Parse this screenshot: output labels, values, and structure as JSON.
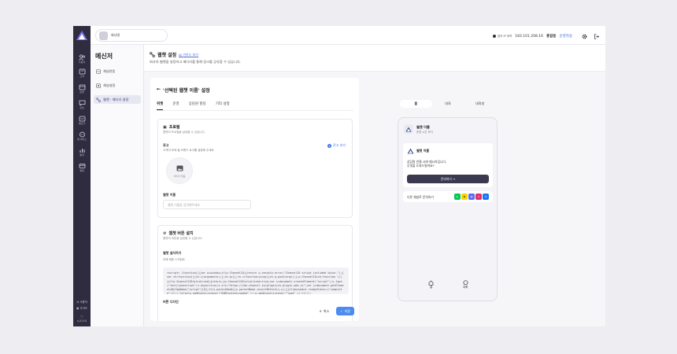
{
  "topbar": {
    "workspace_name": "회사명",
    "ip_label": "접속 IP 대역",
    "ip_address": "183.101.208.16",
    "user_name": "홍길동",
    "user_role": "운영자용"
  },
  "rail": {
    "items": [
      {
        "label": "사용자",
        "icon": "users-icon"
      },
      {
        "label": "고객",
        "icon": "customer-icon"
      },
      {
        "label": "운영",
        "icon": "operation-icon"
      },
      {
        "label": "상담",
        "icon": "chat-icon"
      },
      {
        "label": "메신저",
        "icon": "messenger-icon"
      },
      {
        "label": "봇/서비스",
        "icon": "bot-icon"
      },
      {
        "label": "통계",
        "icon": "stats-icon"
      },
      {
        "label": "결제",
        "icon": "billing-icon"
      }
    ],
    "bottom": {
      "user_label": "사용자",
      "help_label": "가이드",
      "version": "v.2.0.0"
    }
  },
  "sidebar": {
    "title": "메신저",
    "items": [
      {
        "label": "채널연동",
        "active": false
      },
      {
        "label": "채널설정",
        "active": false
      },
      {
        "label": "웹챗 · 메디리 설정",
        "active": true
      }
    ]
  },
  "page_header": {
    "title": "웹챗 설정",
    "guide_link": "가이드 보기",
    "description": "회사의 웹챗을 설정하고 메디리를 통해 링크를 공유할 수 있습니다."
  },
  "panel": {
    "back_title": "'선택된 웹챗 이름' 설정",
    "tabs": [
      "위젯",
      "운영",
      "상담원 할당",
      "기타 설정"
    ],
    "active_tab": 0,
    "profile_card": {
      "title": "프로필",
      "desc": "웹챗의 프로필을 설정할 수 있습니다.",
      "logo_label": "로고",
      "logo_hint": "고객이 보게 될 브랜드 로고를 설정해 주세요",
      "add_logo": "로고 추가",
      "logo_caption": "이미지 없음",
      "name_label": "웹챗 이름",
      "name_placeholder": "웹챗 이름을 입력해주세요"
    },
    "install_card": {
      "title": "웹챗 버튼 설치",
      "desc": "웹챗의 버튼을 설정할 수 있습니다.",
      "section_label": "웹챗 설치하기",
      "section_hint": "아래 제휴 스크립트",
      "code": "<script> (function(){var w=window;if(w.ChannelIO){return w.console.error(\"ChannelIO script included twice.\");}var ch=function(){ch.c(arguments);};ch.q=[];ch.c=function(args){ch.q.push(args);};w.ChannelIO=ch;function l(){if(w.ChannelIOInitialized){return;}w.ChannelIOInitialized=true;var s=document.createElement(\"script\");s.type=\"text/javascript\";s.async=true;s.src=\"https://cdn.channel.io/plugin/ch-plugin-web.js\";var x=document.getElementsByTagName(\"script\")[0];if(x.parentNode){x.parentNode.insertBefore(s,x);}}if(document.readyState===\"complete\"){l();}else{w.addEventListener(\"DOMContentLoaded\",l);w.addEventListener(\"load\",l);}})();",
      "button_design_label": "버튼 디자인"
    },
    "cancel": "취소",
    "save": "저장"
  },
  "preview": {
    "tabs": [
      "홈",
      "대화",
      "대화방"
    ],
    "active_tab": 0,
    "header_name": "웹챗 이름",
    "header_sub": "운영 시간 보기",
    "card_name": "웹챗 이름",
    "message_line1": "상담원 연결 시에 메시지입니다.",
    "message_line2": "무엇을 도와드릴까요?",
    "inquiry_button": "문의하기 →",
    "other_channels": "다른 채널로 문의하기",
    "channel_icons": [
      {
        "name": "line-icon",
        "color": "#06c755",
        "glyph": "L"
      },
      {
        "name": "kakao-icon",
        "color": "#f7d600",
        "glyph": "K"
      },
      {
        "name": "mail-icon",
        "color": "#5b6cf0",
        "glyph": "@"
      },
      {
        "name": "instagram-icon",
        "color": "#e1306c",
        "glyph": "I"
      },
      {
        "name": "facebook-icon",
        "color": "#1877f2",
        "glyph": "f"
      }
    ],
    "nav": [
      {
        "label": "홈",
        "icon": "home-icon"
      },
      {
        "label": "대화",
        "icon": "chat-bubble-icon"
      }
    ]
  },
  "colors": {
    "rail_bg": "#2f2c3f",
    "accent": "#4a8cf0",
    "link": "#3a6fe0"
  }
}
